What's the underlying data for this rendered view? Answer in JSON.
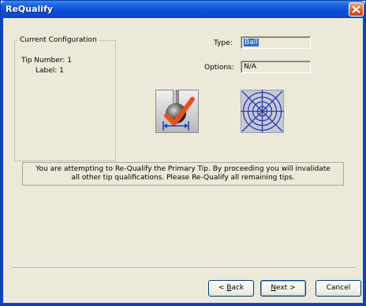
{
  "window": {
    "title": "ReQualify"
  },
  "config": {
    "legend": "Current Configuration",
    "tip_number_label": "Tip Number:",
    "tip_number_value": "1",
    "label_label": "Label:",
    "label_value": "1"
  },
  "fields": {
    "type_label": "Type:",
    "type_value": "Ball",
    "options_label": "Options:",
    "options_value": "N/A"
  },
  "icons": {
    "tip": "ball-tip-check-icon",
    "target": "crosshair-target-icon"
  },
  "message": {
    "line1": "You are attempting to Re-Qualify the Primary Tip. By proceeding you will invalidate",
    "line2": "all other tip qualifications. Please Re-Qualify all remaining tips."
  },
  "buttons": {
    "back_prefix": "< ",
    "back_key": "B",
    "back_rest": "ack",
    "next_key": "N",
    "next_rest": "ext >",
    "cancel": "Cancel"
  }
}
